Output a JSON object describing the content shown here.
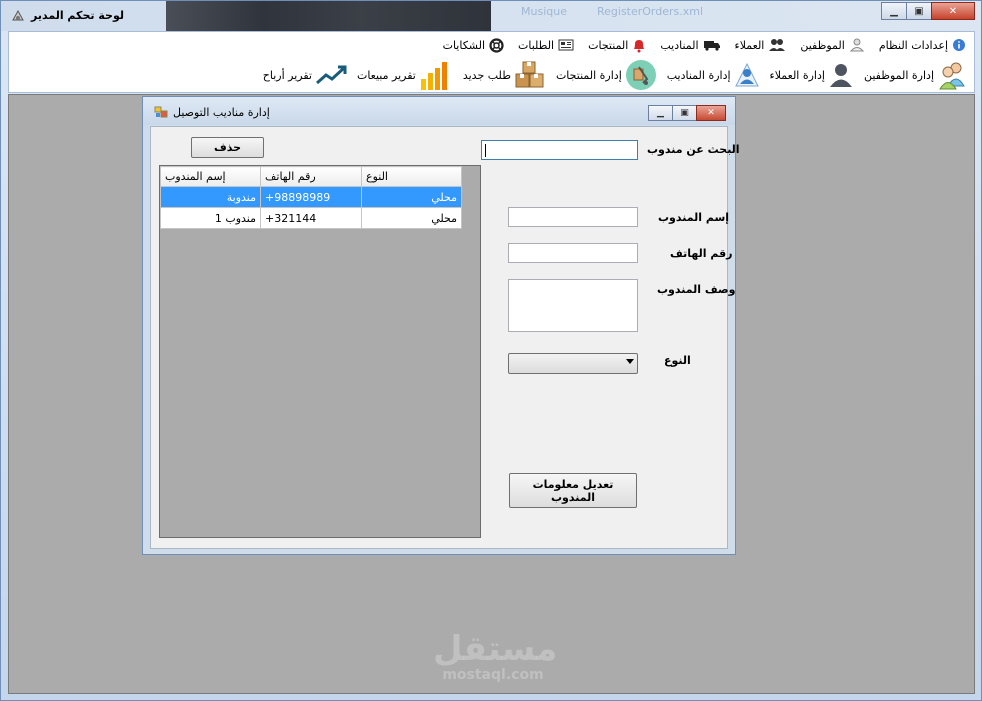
{
  "window": {
    "title": "لوحة تحكم المدير",
    "bg_tabs": [
      "Musique",
      "RegisterOrders.xml"
    ]
  },
  "menu": {
    "items": [
      {
        "label": "إعدادات النظام",
        "icon": "info-icon"
      },
      {
        "label": "الموظفين",
        "icon": "user-icon"
      },
      {
        "label": "العملاء",
        "icon": "customers-icon"
      },
      {
        "label": "المناديب",
        "icon": "truck-icon"
      },
      {
        "label": "المنتجات",
        "icon": "bell-icon"
      },
      {
        "label": "الطلبات",
        "icon": "card-icon"
      },
      {
        "label": "الشكايات",
        "icon": "lifebuoy-icon"
      }
    ]
  },
  "toolbar": {
    "items": [
      {
        "label": "إدارة الموظفين",
        "icon": "employees-icon"
      },
      {
        "label": "إدارة العملاء",
        "icon": "customer-avatar-icon"
      },
      {
        "label": "إدارة المناديب",
        "icon": "delivery-icon"
      },
      {
        "label": "إدارة المنتجات",
        "icon": "package-icon"
      },
      {
        "label": "طلب جديد",
        "icon": "boxes-icon"
      },
      {
        "label": "تقرير مبيعات",
        "icon": "bar-chart-icon"
      },
      {
        "label": "تقرير أرباح",
        "icon": "trend-icon"
      }
    ]
  },
  "dialog": {
    "title": "إدارة مناديب التوصيل",
    "delete_label": "حذف",
    "search_label": "البحث عن مندوب",
    "search_value": "",
    "name_label": "إسم المندوب",
    "phone_label": "رقم الهاتف",
    "desc_label": "وصف المندوب",
    "type_label": "النوع",
    "update_label": "تعديل معلومات المندوب",
    "grid": {
      "headers": [
        "إسم المندوب",
        "رقم الهاتف",
        "النوع"
      ],
      "rows": [
        {
          "name": "مندوبة",
          "phone": "+98898989",
          "type": "محلي",
          "selected": true
        },
        {
          "name": "مندوب 1",
          "phone": "+321144",
          "type": "محلي",
          "selected": false
        }
      ]
    }
  },
  "watermark": {
    "brand_ar": "مستقل",
    "brand_en": "mostaql.com"
  }
}
